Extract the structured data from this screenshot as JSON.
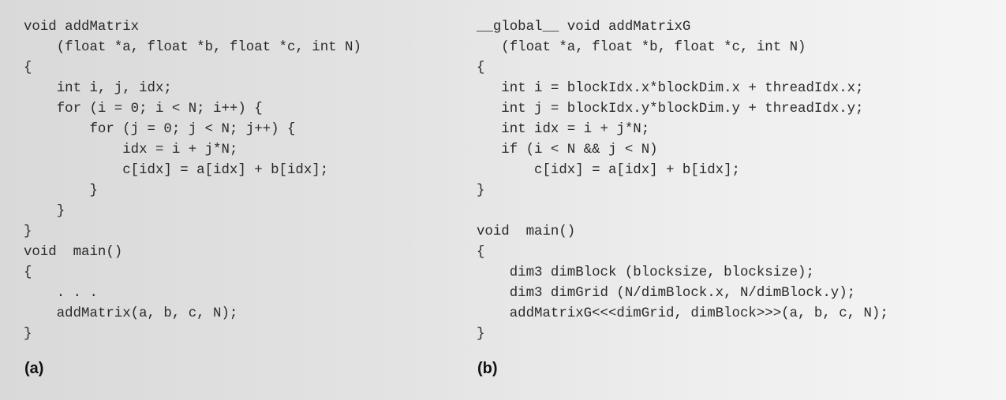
{
  "panel_a": {
    "lines": [
      "void addMatrix",
      "    (float *a, float *b, float *c, int N)",
      "{",
      "    int i, j, idx;",
      "    for (i = 0; i < N; i++) {",
      "        for (j = 0; j < N; j++) {",
      "            idx = i + j*N;",
      "            c[idx] = a[idx] + b[idx];",
      "        }",
      "    }",
      "}",
      "void  main()",
      "{",
      "    . . .",
      "    addMatrix(a, b, c, N);",
      "}"
    ],
    "caption": "(a)"
  },
  "panel_b": {
    "lines": [
      "__global__ void addMatrixG",
      "   (float *a, float *b, float *c, int N)",
      "{",
      "   int i = blockIdx.x*blockDim.x + threadIdx.x;",
      "   int j = blockIdx.y*blockDim.y + threadIdx.y;",
      "   int idx = i + j*N;",
      "   if (i < N && j < N)",
      "       c[idx] = a[idx] + b[idx];",
      "}",
      "",
      "void  main()",
      "{",
      "    dim3 dimBlock (blocksize, blocksize);",
      "    dim3 dimGrid (N/dimBlock.x, N/dimBlock.y);",
      "    addMatrixG<<<dimGrid, dimBlock>>>(a, b, c, N);",
      "}"
    ],
    "caption": "(b)"
  }
}
